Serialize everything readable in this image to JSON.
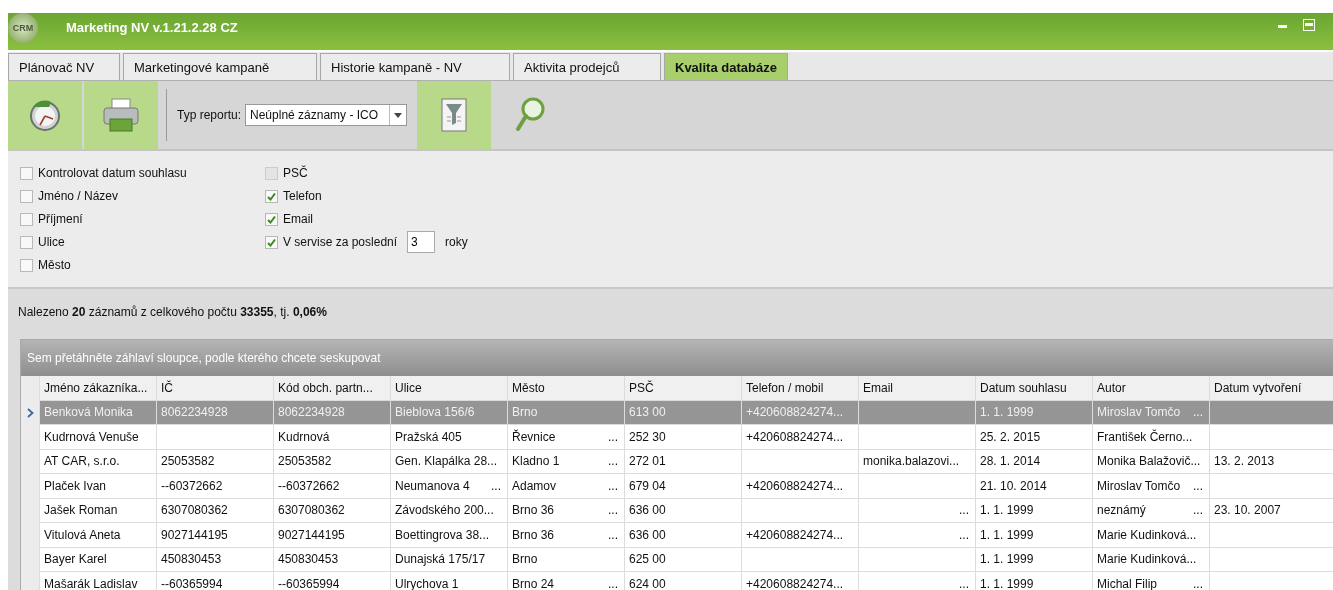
{
  "window": {
    "logo_text": "CRM",
    "title": "Marketing NV v.1.21.2.28 CZ"
  },
  "tabs": [
    {
      "label": "Plánovač NV",
      "selected": false
    },
    {
      "label": "Marketingové kampaně",
      "selected": false
    },
    {
      "label": "Historie kampaně - NV",
      "selected": false
    },
    {
      "label": "Aktivita prodejců",
      "selected": false
    },
    {
      "label": "Kvalita databáze",
      "selected": true
    }
  ],
  "toolbar": {
    "report_label": "Typ reportu:",
    "report_value": "Neúplné záznamy - ICO"
  },
  "filters": {
    "left": [
      {
        "label": "Kontrolovat datum souhlasu",
        "checked": false
      },
      {
        "label": "Jméno / Název",
        "checked": false
      },
      {
        "label": "Příjmení",
        "checked": false
      },
      {
        "label": "Ulice",
        "checked": false
      },
      {
        "label": "Město",
        "checked": false
      }
    ],
    "right": [
      {
        "label": "PSČ",
        "checked": false,
        "disabled": true
      },
      {
        "label": "Telefon",
        "checked": true,
        "disabled": false
      },
      {
        "label": "Email",
        "checked": true,
        "disabled": false
      },
      {
        "label": "V servise za poslední",
        "checked": true,
        "disabled": false,
        "value": "3",
        "suffix": "roky"
      }
    ]
  },
  "summary": "Nalezeno **20** záznamů z celkového počtu **33355**, tj. **0,06%**",
  "grid": {
    "group_hint": "Sem přetáhněte záhlaví sloupce, podle kterého chcete seskupovat",
    "columns": [
      "Jméno zákazníka...",
      "IČ",
      "Kód obch. partn...",
      "Ulice",
      "Město",
      "PSČ",
      "Telefon / mobil",
      "Email",
      "Datum souhlasu",
      "Autor",
      "Datum vytvoření"
    ],
    "rows": [
      {
        "selected": true,
        "cells": [
          "Benková Monika",
          "8062234928",
          "8062234928",
          "Bieblova 156/6",
          "Brno",
          "613 00",
          "+420608824274...",
          "",
          "1. 1. 1999",
          {
            "text": "Miroslav Tomčo",
            "more": "..."
          },
          ""
        ]
      },
      {
        "selected": false,
        "cells": [
          "Kudrnová Venuše",
          "",
          "Kudrnová",
          "Pražská 405",
          {
            "text": "Řevnice",
            "more": "..."
          },
          "252 30",
          "+420608824274...",
          "",
          "25. 2. 2015",
          "František Černo...",
          ""
        ]
      },
      {
        "selected": false,
        "cells": [
          "AT CAR, s.r.o.",
          "25053582",
          "25053582",
          "Gen. Klapálka 28...",
          {
            "text": "Kladno 1",
            "more": "..."
          },
          "272 01",
          "",
          "monika.balazovi...",
          "28. 1. 2014",
          "Monika Balažovič...",
          "13. 2. 2013"
        ]
      },
      {
        "selected": false,
        "cells": [
          "Plaček Ivan",
          "--60372662",
          "--60372662",
          {
            "text": "Neumanova 4",
            "more": "..."
          },
          {
            "text": "Adamov",
            "more": "..."
          },
          "679 04",
          "+420608824274...",
          "",
          "21. 10. 2014",
          {
            "text": "Miroslav Tomčo",
            "more": "..."
          },
          ""
        ]
      },
      {
        "selected": false,
        "cells": [
          "Jašek Roman",
          "6307080362",
          "6307080362",
          "Závodského 200...",
          {
            "text": "Brno 36",
            "more": "..."
          },
          "636 00",
          "",
          {
            "more": "..."
          },
          "1. 1. 1999",
          {
            "text": "neznámý",
            "more": "..."
          },
          "23. 10. 2007"
        ]
      },
      {
        "selected": false,
        "cells": [
          "Vitulová Aneta",
          "9027144195",
          "9027144195",
          "Boettingrova 38...",
          {
            "text": "Brno 36",
            "more": "..."
          },
          "636 00",
          "+420608824274...",
          {
            "more": "..."
          },
          "1. 1. 1999",
          "Marie Kudinková...",
          ""
        ]
      },
      {
        "selected": false,
        "cells": [
          "Bayer Karel",
          "450830453",
          "450830453",
          "Dunajská 175/17",
          "Brno",
          "625 00",
          "",
          "",
          "1. 1. 1999",
          "Marie Kudinková...",
          ""
        ]
      },
      {
        "selected": false,
        "cells": [
          "Mašarák Ladislav",
          "--60365994",
          "--60365994",
          "Ulrychova 1",
          {
            "text": "Brno 24",
            "more": "..."
          },
          "624 00",
          "+420608824274...",
          {
            "more": "..."
          },
          "1. 1. 1999",
          {
            "text": "Michal Filip",
            "more": "..."
          },
          ""
        ]
      }
    ]
  }
}
